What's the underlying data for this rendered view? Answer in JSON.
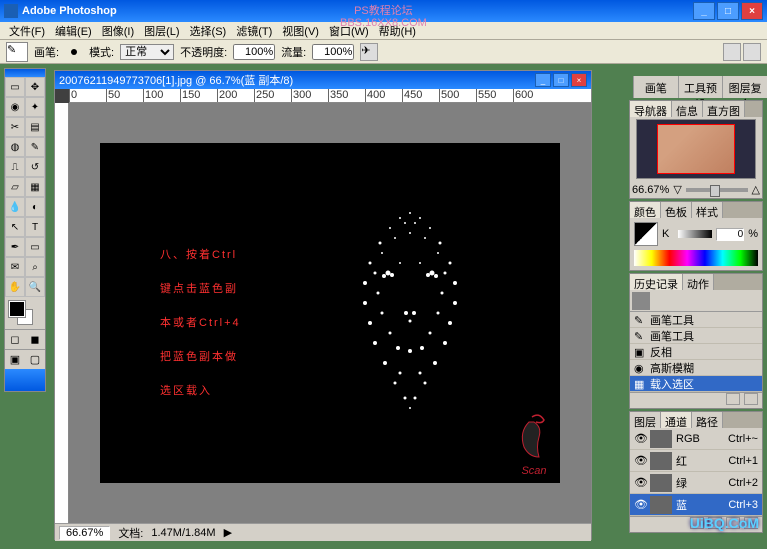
{
  "app": {
    "title": "Adobe Photoshop"
  },
  "watermark": {
    "top_line1": "PS教程论坛",
    "top_line2": "BBS.16XX8.COM",
    "bottom": "UiBQ.CoM"
  },
  "menu": {
    "file": "文件(F)",
    "edit": "编辑(E)",
    "image": "图像(I)",
    "layer": "图层(L)",
    "select": "选择(S)",
    "filter": "滤镜(T)",
    "view": "视图(V)",
    "window": "窗口(W)",
    "help": "帮助(H)"
  },
  "options": {
    "brush_label": "画笔:",
    "mode_label": "模式:",
    "mode_value": "正常",
    "opacity_label": "不透明度:",
    "opacity_value": "100%",
    "flow_label": "流量:",
    "flow_value": "100%"
  },
  "tabstrip": {
    "t1": "画笔",
    "t2": "工具预设",
    "t3": "图层复合"
  },
  "document": {
    "title": "20076211949773706[1].jpg @ 66.7%(蓝 副本/8)",
    "ruler": [
      "0",
      "50",
      "100",
      "150",
      "200",
      "250",
      "300",
      "350",
      "400",
      "450",
      "500",
      "550",
      "600"
    ],
    "instruction": {
      "l1": "八、按着Ctrl",
      "l2": "键点击蓝色副",
      "l3": "本或者Ctrl+4",
      "l4": "把蓝色副本做",
      "l5": "选区载入"
    },
    "stamp": "Scan",
    "status": {
      "zoom": "66.67%",
      "docsize_label": "文档:",
      "docsize": "1.47M/1.84M"
    }
  },
  "panels": {
    "navigator": {
      "tab1": "导航器",
      "tab2": "信息",
      "tab3": "直方图",
      "zoom": "66.67%"
    },
    "color": {
      "tab1": "颜色",
      "tab2": "色板",
      "tab3": "样式",
      "channel": "K",
      "value": "0",
      "pct": "%"
    },
    "history": {
      "tab1": "历史记录",
      "tab2": "动作",
      "items": [
        {
          "label": "画笔工具"
        },
        {
          "label": "画笔工具"
        },
        {
          "label": "反相"
        },
        {
          "label": "高斯模糊"
        },
        {
          "label": "载入选区",
          "selected": true
        }
      ]
    },
    "channels": {
      "tab1": "图层",
      "tab2": "通道",
      "tab3": "路径",
      "items": [
        {
          "label": "RGB",
          "shortcut": "Ctrl+~"
        },
        {
          "label": "红",
          "shortcut": "Ctrl+1"
        },
        {
          "label": "绿",
          "shortcut": "Ctrl+2"
        },
        {
          "label": "蓝",
          "shortcut": "Ctrl+3",
          "selected": true
        }
      ]
    }
  }
}
